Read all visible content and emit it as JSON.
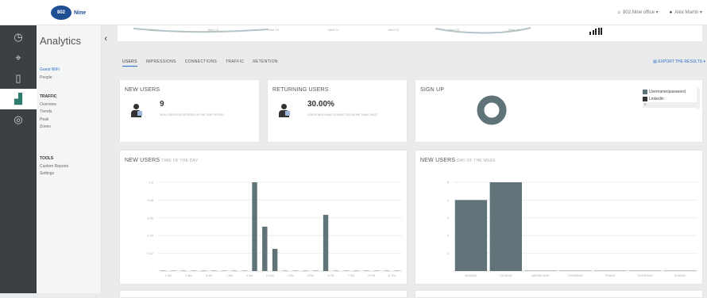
{
  "brand": {
    "logo_text": "802",
    "logo_suffix": "Nine"
  },
  "topbar": {
    "office": "802.Nine office",
    "user": "Alex Martin"
  },
  "sidebar": {
    "title": "Analytics",
    "groups": [
      {
        "items": [
          "Guest WiFi",
          "People"
        ]
      },
      {
        "header": "TRAFFIC",
        "items": [
          "Overview",
          "Trends",
          "Peak",
          "Zones"
        ]
      },
      {
        "header": "TOOLS",
        "items": [
          "Custom Reports",
          "Settings"
        ]
      }
    ]
  },
  "mini_chart": {
    "labels": [
      "Wed 9",
      "Wed 10",
      "Wed 20",
      "Wed 21",
      "Wed 22",
      "Wed 23",
      "Wed 24"
    ]
  },
  "tabs": [
    "USERS",
    "IMPRESSIONS",
    "CONNECTIONS",
    "TRAFFIC",
    "RETENTION"
  ],
  "export_label": "EXPORT THE RESULTS",
  "kpis": {
    "new_users": {
      "title": "NEW USERS",
      "value": "9",
      "desc": "NEW USERS REGISTERED IN THE TIME PERIOD"
    },
    "returning": {
      "title": "RETURNING USERS",
      "value": "30.00%",
      "desc": "USERS WHO HAVE CONNECTED MORE THAN ONCE"
    }
  },
  "signup": {
    "title": "SIGN UP",
    "legend": [
      {
        "label": "Username/password",
        "color": "#5f7378"
      },
      {
        "label": "Linkedin",
        "color": "#333333"
      }
    ],
    "donut": [
      {
        "label": "Username/password",
        "value": 100
      }
    ],
    "closebar": "x"
  },
  "charts": {
    "time_of_day": {
      "title": "NEW USERS",
      "subtitle": "TIME OF THE DAY",
      "chart_data": {
        "type": "bar",
        "title": "NEW USERS · TIME OF THE DAY",
        "categories": [
          "12AM",
          "1AM",
          "2AM",
          "3AM",
          "4AM",
          "5AM",
          "6AM",
          "7AM",
          "8AM",
          "9AM",
          "10AM",
          "11AM",
          "12PM",
          "1PM",
          "2PM",
          "3PM",
          "4PM",
          "5PM",
          "6PM",
          "7PM",
          "8PM",
          "9PM",
          "10PM",
          "11PM"
        ],
        "tick_labels": [
          "1 AM",
          "3 AM",
          "5 AM",
          "7 AM",
          "9 AM",
          "11 AM",
          "1 PM",
          "3 PM",
          "5 PM",
          "7 PM",
          "9 PM",
          "11 PM"
        ],
        "values": [
          0,
          0,
          0,
          0,
          0,
          0,
          0,
          0,
          0,
          0.6,
          0.3,
          0.15,
          0,
          0,
          0,
          0,
          0.38,
          0,
          0,
          0,
          0,
          0,
          0,
          0
        ],
        "yticks": [
          0.12,
          0.24,
          0.36,
          0.48,
          0.6
        ],
        "ylim": [
          0,
          0.6
        ],
        "color": "#5f7378"
      }
    },
    "day_of_week": {
      "title": "NEW USERS",
      "subtitle": "DAY OF THE WEEK",
      "chart_data": {
        "type": "bar",
        "title": "NEW USERS · DAY OF THE WEEK",
        "categories": [
          "MONDAY",
          "TUESDAY",
          "WEDNESDAY",
          "THURSDAY",
          "FRIDAY",
          "SATURDAY",
          "SUNDAY"
        ],
        "values": [
          4.0,
          5.0,
          0,
          0,
          0,
          0,
          0
        ],
        "yticks": [
          1,
          2,
          3,
          4,
          5
        ],
        "ylim": [
          0,
          5
        ],
        "color": "#5f7378"
      }
    }
  }
}
